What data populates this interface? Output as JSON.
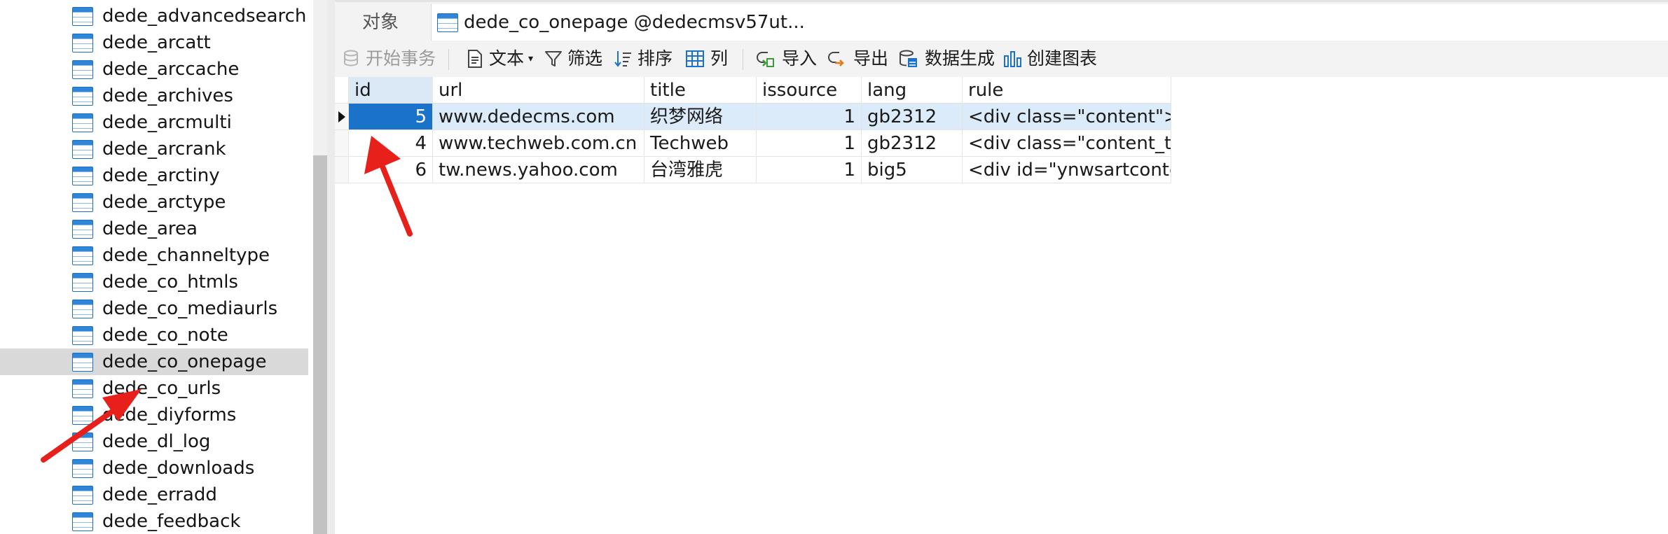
{
  "sidebar": {
    "items": [
      {
        "label": "dede_advancedsearch"
      },
      {
        "label": "dede_arcatt"
      },
      {
        "label": "dede_arccache"
      },
      {
        "label": "dede_archives"
      },
      {
        "label": "dede_arcmulti"
      },
      {
        "label": "dede_arcrank"
      },
      {
        "label": "dede_arctiny"
      },
      {
        "label": "dede_arctype"
      },
      {
        "label": "dede_area"
      },
      {
        "label": "dede_channeltype"
      },
      {
        "label": "dede_co_htmls"
      },
      {
        "label": "dede_co_mediaurls"
      },
      {
        "label": "dede_co_note"
      },
      {
        "label": "dede_co_onepage",
        "selected": true
      },
      {
        "label": "dede_co_urls"
      },
      {
        "label": "dede_diyforms"
      },
      {
        "label": "dede_dl_log"
      },
      {
        "label": "dede_downloads"
      },
      {
        "label": "dede_erradd"
      },
      {
        "label": "dede_feedback"
      }
    ]
  },
  "tabs": {
    "objects": "对象",
    "table": "dede_co_onepage @dedecmsv57ut..."
  },
  "toolbar": {
    "begin_transaction": "开始事务",
    "text": "文本",
    "filter": "筛选",
    "sort": "排序",
    "columns": "列",
    "import": "导入",
    "export": "导出",
    "data_generation": "数据生成",
    "create_chart": "创建图表"
  },
  "grid": {
    "columns": [
      "id",
      "url",
      "title",
      "issource",
      "lang",
      "rule"
    ],
    "rows": [
      {
        "id": "5",
        "url": "www.dedecms.com",
        "title": "织梦网络",
        "issource": "1",
        "lang": "gb2312",
        "rule": "<div class=\"content\">{@",
        "selected": true
      },
      {
        "id": "4",
        "url": "www.techweb.com.cn",
        "title": "Techweb",
        "issource": "1",
        "lang": "gb2312",
        "rule": "<div class=\"content_txt\""
      },
      {
        "id": "6",
        "url": "tw.news.yahoo.com",
        "title": "台湾雅虎",
        "issource": "1",
        "lang": "big5",
        "rule": "<div id=\"ynwsartcontent"
      }
    ]
  },
  "colors": {
    "accent": "#1a73c9",
    "selected_row": "#dcebf9",
    "annotation_arrow": "#e8201c"
  }
}
